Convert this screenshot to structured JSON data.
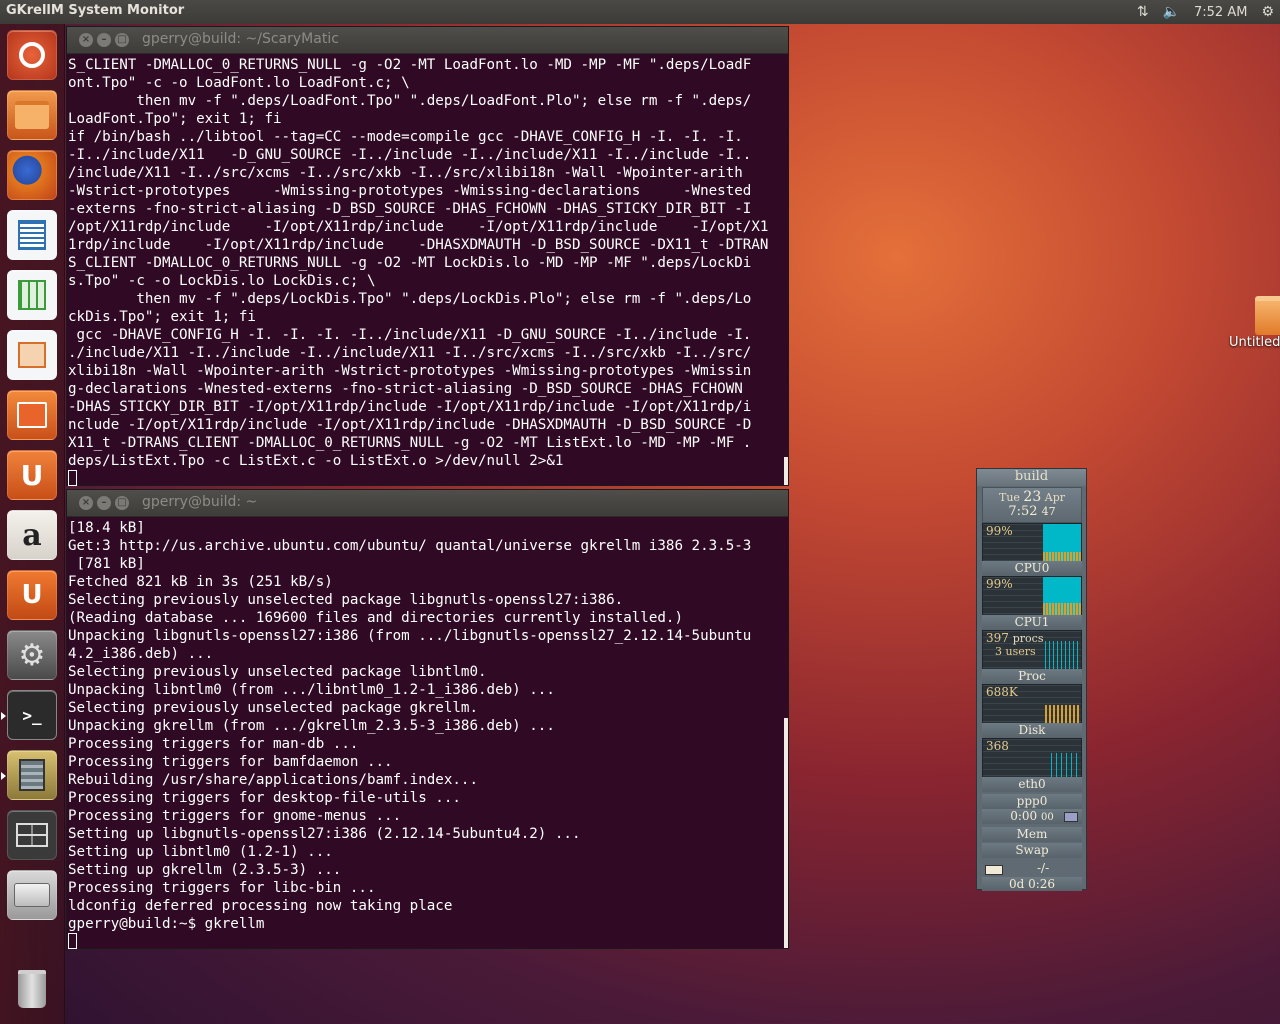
{
  "top_panel": {
    "app_title": "GKrellM System Monitor",
    "clock": "7:52 AM",
    "icons": [
      "network-transfer-icon",
      "volume-icon",
      "gear-icon"
    ]
  },
  "launcher": {
    "items": [
      {
        "name": "ubuntu-dash",
        "icon": "ubuntu-logo-icon",
        "color": "#d9461f"
      },
      {
        "name": "files",
        "icon": "folder-icon",
        "color": "#e8772e"
      },
      {
        "name": "firefox",
        "icon": "firefox-icon",
        "color": "#e06a1b"
      },
      {
        "name": "libreoffice-writer",
        "icon": "writer-icon",
        "color": "#2f6fb4"
      },
      {
        "name": "libreoffice-calc",
        "icon": "calc-icon",
        "color": "#3a9a3c"
      },
      {
        "name": "libreoffice-impress",
        "icon": "impress-icon",
        "color": "#d5702a"
      },
      {
        "name": "software-center",
        "icon": "shopping-bag-icon",
        "color": "#e0691c"
      },
      {
        "name": "ubuntu-one",
        "icon": "ubuntu-one-icon",
        "color": "#e7641d"
      },
      {
        "name": "amazon",
        "icon": "amazon-icon",
        "color": "#e5e1db"
      },
      {
        "name": "ubuntu-one-music",
        "icon": "ubuntu-one-music-icon",
        "color": "#e0591a"
      },
      {
        "name": "system-settings",
        "icon": "settings-icon",
        "color": "#6a6a6a"
      },
      {
        "name": "terminal",
        "icon": "terminal-icon",
        "color": "#2d2d2d"
      },
      {
        "name": "gkrellm",
        "icon": "gkrellm-icon",
        "color": "#b8a45a"
      },
      {
        "name": "workspace-switcher",
        "icon": "workspaces-icon",
        "color": "#4a4a4a"
      },
      {
        "name": "disk",
        "icon": "disk-icon",
        "color": "#b9b9b9"
      }
    ],
    "trash": {
      "icon": "trash-icon",
      "color": "#8a8a8a"
    }
  },
  "terminal1": {
    "title": "gperry@build: ~/ScaryMatic",
    "lines": [
      "S_CLIENT -DMALLOC_0_RETURNS_NULL -g -O2 -MT LoadFont.lo -MD -MP -MF \".deps/LoadF",
      "ont.Tpo\" -c -o LoadFont.lo LoadFont.c; \\",
      "        then mv -f \".deps/LoadFont.Tpo\" \".deps/LoadFont.Plo\"; else rm -f \".deps/",
      "LoadFont.Tpo\"; exit 1; fi",
      "if /bin/bash ../libtool --tag=CC --mode=compile gcc -DHAVE_CONFIG_H -I. -I. -I.",
      "-I../include/X11   -D_GNU_SOURCE -I../include -I../include/X11 -I../include -I..",
      "/include/X11 -I../src/xcms -I../src/xkb -I../src/xlibi18n -Wall -Wpointer-arith",
      "-Wstrict-prototypes     -Wmissing-prototypes -Wmissing-declarations     -Wnested",
      "-externs -fno-strict-aliasing -D_BSD_SOURCE -DHAS_FCHOWN -DHAS_STICKY_DIR_BIT -I",
      "/opt/X11rdp/include    -I/opt/X11rdp/include    -I/opt/X11rdp/include    -I/opt/X1",
      "1rdp/include    -I/opt/X11rdp/include    -DHASXDMAUTH -D_BSD_SOURCE -DX11_t -DTRAN",
      "S_CLIENT -DMALLOC_0_RETURNS_NULL -g -O2 -MT LockDis.lo -MD -MP -MF \".deps/LockDi",
      "s.Tpo\" -c -o LockDis.lo LockDis.c; \\",
      "        then mv -f \".deps/LockDis.Tpo\" \".deps/LockDis.Plo\"; else rm -f \".deps/Lo",
      "ckDis.Tpo\"; exit 1; fi",
      " gcc -DHAVE_CONFIG_H -I. -I. -I. -I../include/X11 -D_GNU_SOURCE -I../include -I.",
      "./include/X11 -I../include -I../include/X11 -I../src/xcms -I../src/xkb -I../src/",
      "xlibi18n -Wall -Wpointer-arith -Wstrict-prototypes -Wmissing-prototypes -Wmissin",
      "g-declarations -Wnested-externs -fno-strict-aliasing -D_BSD_SOURCE -DHAS_FCHOWN",
      "-DHAS_STICKY_DIR_BIT -I/opt/X11rdp/include -I/opt/X11rdp/include -I/opt/X11rdp/i",
      "nclude -I/opt/X11rdp/include -I/opt/X11rdp/include -DHASXDMAUTH -D_BSD_SOURCE -D",
      "X11_t -DTRANS_CLIENT -DMALLOC_0_RETURNS_NULL -g -O2 -MT ListExt.lo -MD -MP -MF .",
      "deps/ListExt.Tpo -c ListExt.c -o ListExt.o >/dev/null 2>&1"
    ]
  },
  "terminal2": {
    "title": "gperry@build: ~",
    "lines": [
      "[18.4 kB]",
      "Get:3 http://us.archive.ubuntu.com/ubuntu/ quantal/universe gkrellm i386 2.3.5-3",
      " [781 kB]",
      "Fetched 821 kB in 3s (251 kB/s)",
      "Selecting previously unselected package libgnutls-openssl27:i386.",
      "(Reading database ... 169600 files and directories currently installed.)",
      "Unpacking libgnutls-openssl27:i386 (from .../libgnutls-openssl27_2.12.14-5ubuntu",
      "4.2_i386.deb) ...",
      "Selecting previously unselected package libntlm0.",
      "Unpacking libntlm0 (from .../libntlm0_1.2-1_i386.deb) ...",
      "Selecting previously unselected package gkrellm.",
      "Unpacking gkrellm (from .../gkrellm_2.3.5-3_i386.deb) ...",
      "Processing triggers for man-db ...",
      "Processing triggers for bamfdaemon ...",
      "Rebuilding /usr/share/applications/bamf.index...",
      "Processing triggers for desktop-file-utils ...",
      "Processing triggers for gnome-menus ...",
      "Setting up libgnutls-openssl27:i386 (2.12.14-5ubuntu4.2) ...",
      "Setting up libntlm0 (1.2-1) ...",
      "Setting up gkrellm (2.3.5-3) ...",
      "Processing triggers for libc-bin ...",
      "ldconfig deferred processing now taking place",
      "gperry@build:~$ gkrellm"
    ]
  },
  "gkrellm": {
    "hostname": "build",
    "date_day": "Tue",
    "date_num": "23",
    "date_month": "Apr",
    "time_hm": "7:52",
    "time_s": "47",
    "cpu_total_pct": "99%",
    "cpu0_label": "CPU0",
    "cpu0_pct": "99%",
    "cpu1_label": "CPU1",
    "procs": "397",
    "procs_unit": "procs",
    "users": "3",
    "users_unit": "users",
    "proc_label": "Proc",
    "disk_value": "688K",
    "disk_label": "Disk",
    "eth0_value": "368",
    "eth0_label": "eth0",
    "ppp0_label": "ppp0",
    "ppp0_timer": "0:00",
    "ppp0_timer_sub": "00",
    "mem_label": "Mem",
    "swap_label": "Swap",
    "mail_count": "-/-",
    "uptime": "0d  0:26"
  },
  "desktop": {
    "folder_label": "Untitled"
  }
}
